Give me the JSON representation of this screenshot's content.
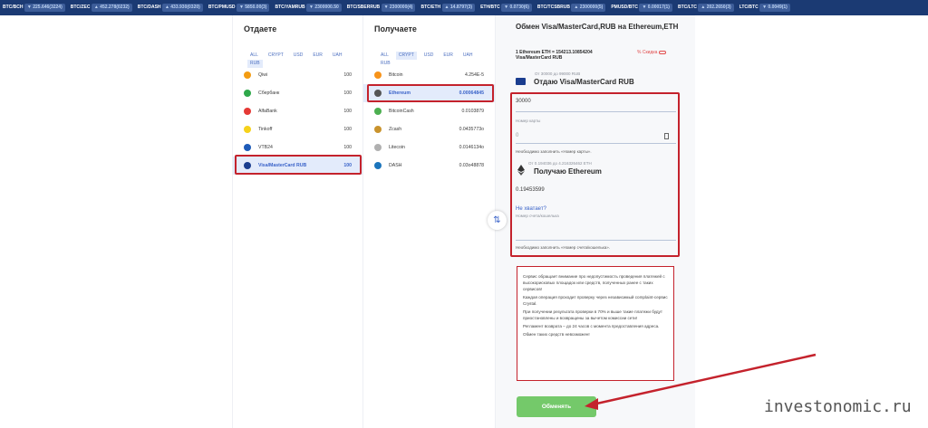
{
  "ticker": [
    {
      "pair": "BTC/BCH",
      "val": "▼ 225.646(3224)"
    },
    {
      "pair": "BTC/ZEC",
      "val": "▲ 452.278(0232)"
    },
    {
      "pair": "BTC/DASH",
      "val": "▲ 433.930(0320)"
    },
    {
      "pair": "BTC/PMUSD",
      "val": "▼ 5850.00(3)"
    },
    {
      "pair": "BTC/YAMRUB",
      "val": "▼ 2300000.50"
    },
    {
      "pair": "BTC/SBERRUB",
      "val": "▼ 2300000(4)"
    },
    {
      "pair": "BTC/ETH",
      "val": "▲ 14.8797(3)"
    },
    {
      "pair": "ETH/BTC",
      "val": "▼ 0.0730(6)"
    },
    {
      "pair": "BTC/TCSBRUB",
      "val": "▲ 2300000(5)"
    },
    {
      "pair": "PMUSD/BTC",
      "val": "▼ 0.00017(1)"
    },
    {
      "pair": "BTC/LTC",
      "val": "▲ 202.2650(3)"
    },
    {
      "pair": "LTC/BTC",
      "val": "▼ 0.0049(1)"
    }
  ],
  "give": {
    "title": "Отдаете",
    "filters": [
      "ALL",
      "CRYPT",
      "USD",
      "EUR",
      "UAH",
      "RUB"
    ],
    "active_filter": 5,
    "items": [
      {
        "name": "Qiwi",
        "value": "100",
        "color": "#f39c12"
      },
      {
        "name": "Сбербанк",
        "value": "100",
        "color": "#2ea84a"
      },
      {
        "name": "AlfaBank",
        "value": "100",
        "color": "#e53935"
      },
      {
        "name": "Tinkoff",
        "value": "100",
        "color": "#f6d21b"
      },
      {
        "name": "VTB24",
        "value": "100",
        "color": "#1e5bb8"
      },
      {
        "name": "Visa/MasterCard RUB",
        "value": "100",
        "color": "#1a3d8f"
      }
    ],
    "selected": 5
  },
  "get": {
    "title": "Получаете",
    "filters": [
      "ALL",
      "CRYPT",
      "USD",
      "EUR",
      "UAH",
      "RUB"
    ],
    "active_filter": 1,
    "items": [
      {
        "name": "Bitcoin",
        "value": "4.254E-5",
        "color": "#f7931a"
      },
      {
        "name": "Ethereum",
        "value": "0.00064845",
        "color": "#555555"
      },
      {
        "name": "BitcoinCash",
        "value": "0.0103879",
        "color": "#4caf50"
      },
      {
        "name": "Zcash",
        "value": "0.0435773o",
        "color": "#c9932d"
      },
      {
        "name": "Litecoin",
        "value": "0.0146134o",
        "color": "#b0b0b0"
      },
      {
        "name": "DASH",
        "value": "0.03o48878",
        "color": "#1c75bc"
      }
    ],
    "selected": 1
  },
  "exchange": {
    "title": "Обмен Visa/MasterCard,RUB на Ethereum,ETH",
    "rate_line1": "1 Ethereum ETH = 154213.10854204",
    "rate_line2": "Visa/MasterCard RUB",
    "discount": "% Скидка",
    "give_range": "От 30000 до 99000 RUB",
    "give_label": "Отдаю Visa/MasterCard RUB",
    "amount": "30000",
    "card_label": "Номер карты",
    "card_value": "0",
    "card_warn": "Необходимо заполнить «Номер карты».",
    "get_range": "От 0.194036 до 4.216326462 ETH",
    "get_label": "Получаю Ethereum",
    "get_amount": "0.19453599",
    "not_enough": "Не хватает?",
    "wallet_label": "Номер счета/кошелька",
    "wallet_warn": "Необходимо заполнить «Номер счета/кошелька».",
    "info": [
      "Сервис обращает внимание про недопустимость проведения платежей с высокорисковых площадок или средств, полученных ранее с таких сервисов!",
      "Каждая операция проходит проверку через независимый complaint-сервис Crystal.",
      "При получении результата проверки в 70% и выше такие платежи будут приостановлены и возвращены за вычетом комиссии сети!",
      "Регламент возврата – до 24 часов с момента предоставления адреса.",
      "Обмен таких средств невозможен!"
    ],
    "button": "Обменять"
  },
  "watermark": "investonomic.ru",
  "colors": {
    "accent": "#3a63c9",
    "annotation": "#c4222c",
    "button": "#74c96a",
    "ticker": "#1b3a73"
  }
}
